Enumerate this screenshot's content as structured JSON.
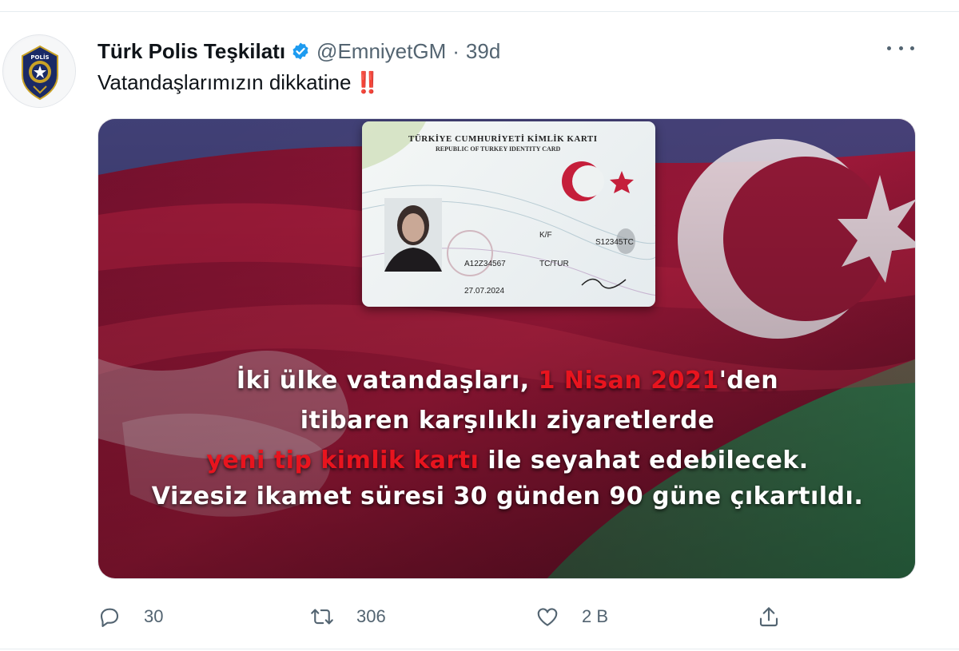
{
  "tweet": {
    "author_name": "Türk Polis Teşkilatı",
    "handle": "@EmniyetGM",
    "separator": "·",
    "time": "39d",
    "text": "Vatandaşlarımızın dikkatine",
    "emoji": "‼️",
    "avatar_text": "POLİS"
  },
  "media": {
    "card": {
      "title_line1": "TÜRKİYE CUMHURİYETİ KİMLİK KARTI",
      "title_line2": "REPUBLIC OF TURKEY IDENTITY CARD",
      "gender": "K/F",
      "serial": "S12345TC",
      "document_no": "A12Z34567",
      "nationality": "TC/TUR",
      "valid_until": "27.07.2024"
    },
    "text": {
      "line1_a": "İki ülke vatandaşları, ",
      "line1_highlight": "1 Nisan 2021",
      "line1_b": "'den",
      "line2": "itibaren karşılıklı ziyaretlerde",
      "line3_highlight": "yeni tip kimlik kartı",
      "line3_b": " ile seyahat edebilecek.",
      "line4": "Vizesiz ikamet süresi 30 günden 90 güne çıkartıldı."
    }
  },
  "actions": {
    "replies": "30",
    "retweets": "306",
    "likes": "2 B"
  },
  "icons": {
    "verified": "verified-badge-icon",
    "more": "more-icon",
    "reply": "reply-icon",
    "retweet": "retweet-icon",
    "like": "heart-icon",
    "share": "share-icon"
  },
  "colors": {
    "verified": "#1d9bf0",
    "muted": "#536471",
    "highlight_red": "#e8141e"
  }
}
